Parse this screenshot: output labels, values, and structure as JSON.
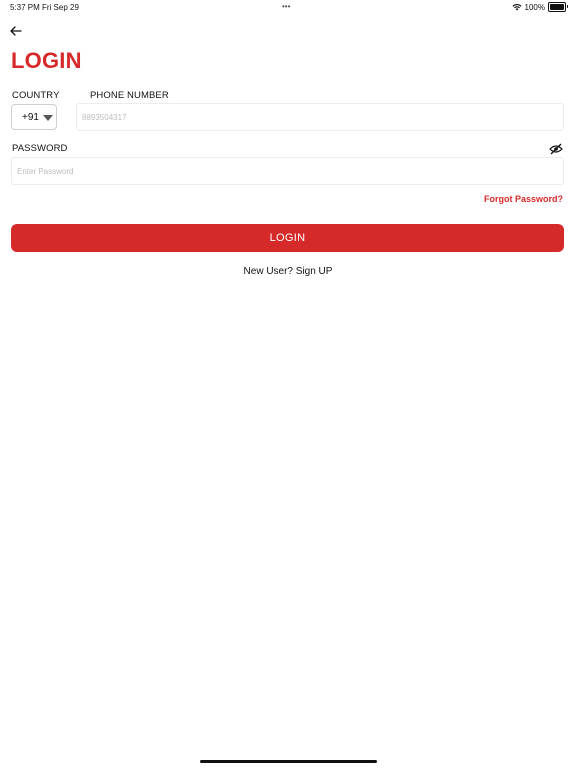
{
  "status_bar": {
    "time": "5:37 PM",
    "date": "Fri Sep 29",
    "dots": "•••",
    "battery": "100%",
    "battery_level": 1.0
  },
  "header": {
    "back_icon": "arrow-left-icon",
    "title": "LOGIN"
  },
  "form": {
    "country_label": "COUNTRY",
    "country_code": "+91",
    "phone_label": "PHONE NUMBER",
    "phone_placeholder": "8893504317",
    "password_label": "PASSWORD",
    "password_placeholder": "Enter Password",
    "password_toggle_icon": "eye-off-icon",
    "forgot_password": "Forgot Password?",
    "login_button": "LOGIN",
    "signup_text": "New User? Sign UP"
  },
  "colors": {
    "accent": "#d62a2a",
    "background": "#ffffff"
  }
}
